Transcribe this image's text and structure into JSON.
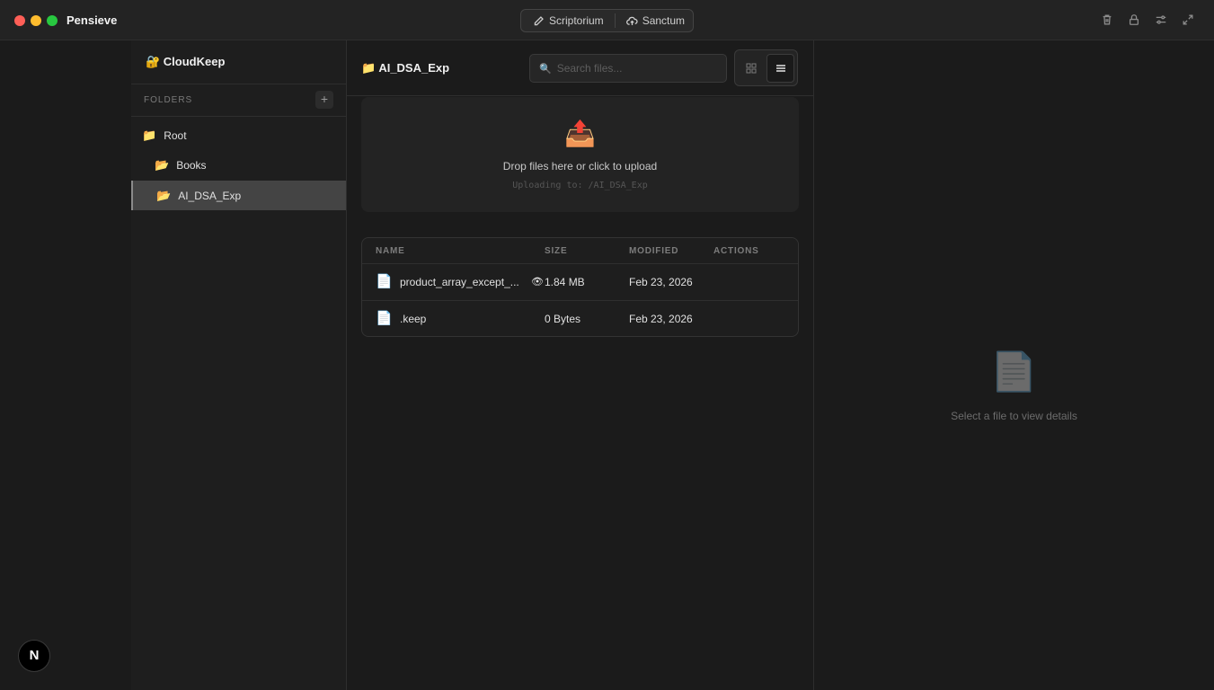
{
  "app": {
    "title": "Pensieve",
    "modes": [
      {
        "label": "Scriptorium",
        "icon": "pencil-icon"
      },
      {
        "label": "Sanctum",
        "icon": "cloud-upload-icon"
      }
    ],
    "toolbar_icons": [
      "trash-icon",
      "lock-icon",
      "settings-sliders-icon",
      "expand-icon"
    ]
  },
  "sidebar": {
    "brand": "🔐 CloudKeep",
    "section_label": "FOLDERS",
    "add_label": "+",
    "tree": [
      {
        "label": "Root",
        "icon": "📁"
      },
      {
        "label": "Books",
        "icon": "📂"
      },
      {
        "label": "AI_DSA_Exp",
        "icon": "📂",
        "selected": true
      }
    ],
    "badge": "N"
  },
  "main": {
    "path_title": "📁 AI_DSA_Exp",
    "search": {
      "icon": "🔍",
      "placeholder": "Search files...",
      "value": ""
    },
    "view_modes": [
      "grid",
      "list"
    ],
    "active_view": "list",
    "dropzone": {
      "icon": "📤",
      "text": "Drop files here or click to upload",
      "subtext": "Uploading to: /AI_DSA_Exp"
    },
    "table": {
      "columns": [
        "NAME",
        "SIZE",
        "MODIFIED",
        "ACTIONS"
      ],
      "rows": [
        {
          "icon": "📄",
          "name": "product_array_except_...",
          "preview_icon": "👁",
          "size": "1.84 MB",
          "modified": "Feb 23, 2026"
        },
        {
          "icon": "📄",
          "name": ".keep",
          "size": "0 Bytes",
          "modified": "Feb 23, 2026"
        }
      ]
    }
  },
  "details": {
    "icon": "📄",
    "empty_text": "Select a file to view details"
  },
  "colors": {
    "background": "#1b1b1b",
    "panel": "#1e1e1e",
    "selected": "#444444",
    "close": "#ff5f57",
    "minimize": "#febc2e",
    "maximize": "#28c840"
  }
}
